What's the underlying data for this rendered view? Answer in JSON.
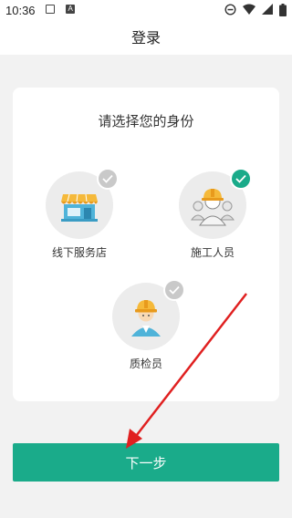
{
  "status_bar": {
    "time": "10:36",
    "icons": [
      "notification-square-icon",
      "notification-a-icon",
      "do-not-disturb-icon",
      "wifi-icon",
      "signal-icon",
      "battery-icon"
    ]
  },
  "header": {
    "title": "登录"
  },
  "card": {
    "title": "请选择您的身份",
    "roles": [
      {
        "label": "线下服务店",
        "icon": "store-icon",
        "selected": false
      },
      {
        "label": "施工人员",
        "icon": "construction-workers-icon",
        "selected": true
      },
      {
        "label": "质检员",
        "icon": "inspector-icon",
        "selected": false
      }
    ]
  },
  "next_button": {
    "label": "下一步"
  },
  "colors": {
    "accent": "#1aab8a",
    "annotation_arrow": "#e02020",
    "unchecked": "#c9c9c9"
  }
}
